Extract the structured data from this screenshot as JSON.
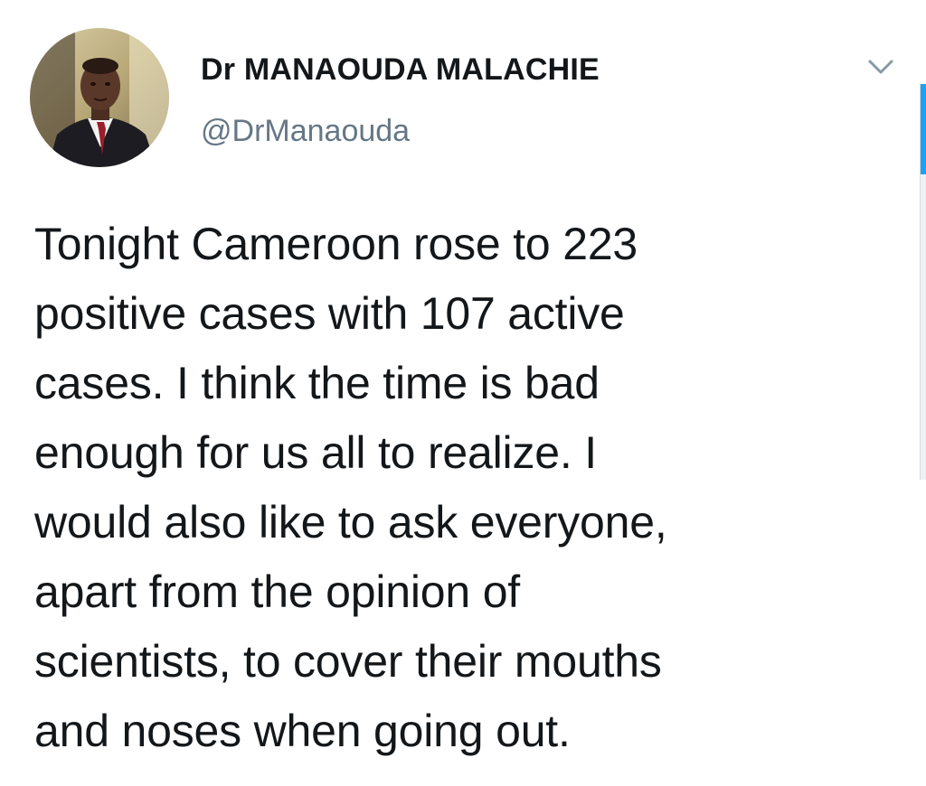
{
  "author": {
    "display_name": "Dr MANAOUDA MALACHIE",
    "handle": "@DrManaouda",
    "avatar_icon": "profile-photo"
  },
  "menu": {
    "icon": "chevron-down-icon"
  },
  "tweet": {
    "lines": [
      "Tonight Cameroon rose to 223",
      "positive cases with 107 active",
      "cases. I think the time is bad",
      "enough for us all to realize. I",
      "would also like to ask everyone,",
      "apart from the opinion of",
      "scientists, to cover their mouths",
      "and noses when going out."
    ]
  },
  "colors": {
    "text": "#14171a",
    "handle": "#657786",
    "accent": "#1da1f2"
  }
}
